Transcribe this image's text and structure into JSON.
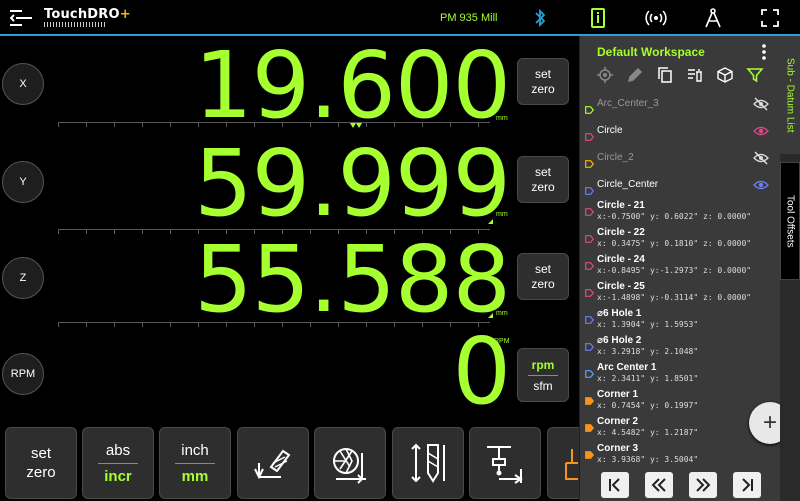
{
  "app": {
    "logo_text": "TouchDRO",
    "logo_plus": "+",
    "machine_name": "PM 935 Mill"
  },
  "colors": {
    "accent_green": "#a6ff2e",
    "topbar_border": "#2a9fd6",
    "panel_bg": "#3a3a3a"
  },
  "axes": [
    {
      "label": "X",
      "value": "19.600",
      "unit": "mm",
      "set_zero_line1": "set",
      "set_zero_line2": "zero"
    },
    {
      "label": "Y",
      "value": "59.999",
      "unit": "mm",
      "set_zero_line1": "set",
      "set_zero_line2": "zero"
    },
    {
      "label": "Z",
      "value": "55.588",
      "unit": "mm",
      "set_zero_line1": "set",
      "set_zero_line2": "zero"
    }
  ],
  "rpm": {
    "label": "RPM",
    "value": "0",
    "unit": "RPM",
    "mode_active": "rpm",
    "mode_other": "sfm"
  },
  "toolbar": {
    "set_zero_line1": "set",
    "set_zero_line2": "zero",
    "abs": "abs",
    "incr": "incr",
    "inch": "inch",
    "mm": "mm"
  },
  "panel": {
    "title": "Default Workspace",
    "items": [
      {
        "name": "Arc_Center_3",
        "coords": "",
        "style": "dim",
        "tag_color": "#a6ff2e",
        "tag_shape": "outline",
        "eye": "hidden"
      },
      {
        "name": "Circle",
        "coords": "",
        "style": "normal",
        "tag_color": "#e0488a",
        "tag_shape": "outline",
        "eye": "visible-pink"
      },
      {
        "name": "Circle_2",
        "coords": "",
        "style": "dim",
        "tag_color": "#f7b800",
        "tag_shape": "outline",
        "eye": "hidden"
      },
      {
        "name": "Circle_Center",
        "coords": "",
        "style": "normal",
        "tag_color": "#6a7cff",
        "tag_shape": "outline",
        "eye": "visible-blue"
      },
      {
        "name": "Circle - 21",
        "coords": "x:-0.7500\" y: 0.6022\" z: 0.0000\"",
        "style": "bold",
        "tag_color": "#e0488a",
        "tag_shape": "outline",
        "eye": ""
      },
      {
        "name": "Circle - 22",
        "coords": "x: 0.3475\" y: 0.1810\" z: 0.0000\"",
        "style": "bold",
        "tag_color": "#e0488a",
        "tag_shape": "outline",
        "eye": ""
      },
      {
        "name": "Circle - 24",
        "coords": "x:-0.8495\" y:-1.2973\" z: 0.0000\"",
        "style": "bold",
        "tag_color": "#e0488a",
        "tag_shape": "outline",
        "eye": ""
      },
      {
        "name": "Circle - 25",
        "coords": "x:-1.4898\" y:-0.3114\" z: 0.0000\"",
        "style": "bold",
        "tag_color": "#e0488a",
        "tag_shape": "outline",
        "eye": ""
      },
      {
        "name": "⌀6 Hole 1",
        "coords": "x: 1.3904\" y: 1.5953\"",
        "style": "bold",
        "tag_color": "#6a7cff",
        "tag_shape": "outline",
        "eye": ""
      },
      {
        "name": "⌀6 Hole 2",
        "coords": "x: 3.2918\" y: 2.1048\"",
        "style": "bold",
        "tag_color": "#6a7cff",
        "tag_shape": "outline",
        "eye": ""
      },
      {
        "name": "Arc Center 1",
        "coords": "x: 2.3411\" y: 1.8501\"",
        "style": "bold",
        "tag_color": "#4aa8ff",
        "tag_shape": "outline",
        "eye": ""
      },
      {
        "name": "Corner 1",
        "coords": "x: 0.7454\" y: 0.1997\"",
        "style": "bold",
        "tag_color": "#f7941d",
        "tag_shape": "filled",
        "eye": ""
      },
      {
        "name": "Corner 2",
        "coords": "x: 4.5482\" y: 1.2187\"",
        "style": "bold",
        "tag_color": "#f7941d",
        "tag_shape": "filled",
        "eye": ""
      },
      {
        "name": "Corner 3",
        "coords": "x: 3.9368\" y: 3.5004\"",
        "style": "bold",
        "tag_color": "#f7941d",
        "tag_shape": "filled",
        "eye": ""
      }
    ],
    "fab_label": "+"
  },
  "side_tabs": {
    "tab1": "Sub - Datum List",
    "tab2": "Tool Offsets"
  },
  "icons": {
    "menu": "menu-collapse-icon",
    "bluetooth": "bluetooth-icon",
    "calculator": "calculator-icon",
    "broadcast": "broadcast-icon",
    "compass": "compass-icon",
    "fullscreen": "fullscreen-icon"
  }
}
